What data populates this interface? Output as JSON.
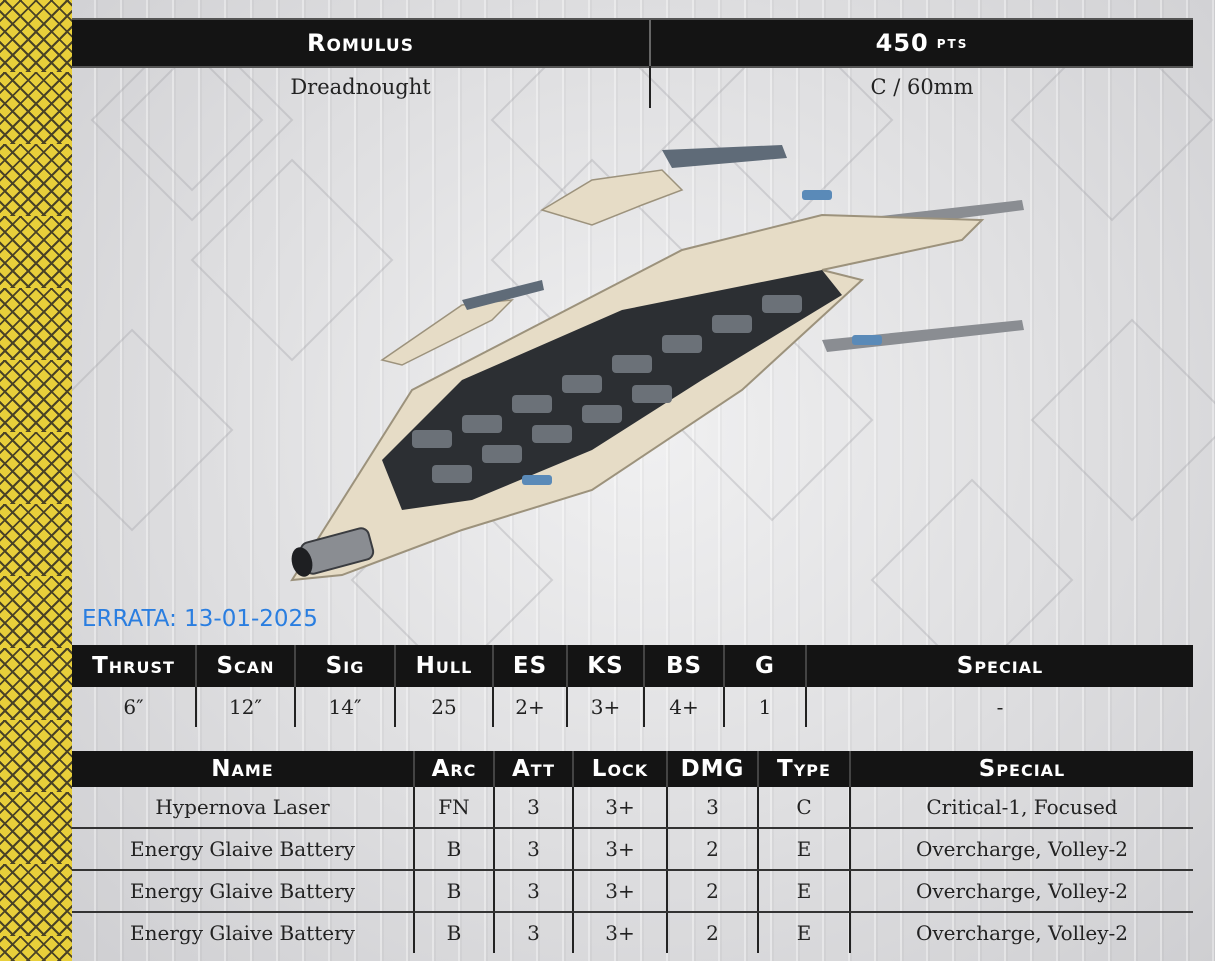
{
  "header": {
    "name": "Romulus",
    "points": "450",
    "points_unit": "pts",
    "class": "Dreadnought",
    "base": "C / 60mm"
  },
  "errata": "ERRATA: 13-01-2025",
  "stats": {
    "headers": [
      "Thrust",
      "Scan",
      "Sig",
      "Hull",
      "ES",
      "KS",
      "BS",
      "G",
      "Special"
    ],
    "values": [
      "6″",
      "12″",
      "14″",
      "25",
      "2+",
      "3+",
      "4+",
      "1",
      "-"
    ]
  },
  "weapons": {
    "headers": [
      "Name",
      "Arc",
      "Att",
      "Lock",
      "DMG",
      "Type",
      "Special"
    ],
    "rows": [
      [
        "Hypernova Laser",
        "FN",
        "3",
        "3+",
        "3",
        "C",
        "Critical-1, Focused"
      ],
      [
        "Energy Glaive Battery",
        "B",
        "3",
        "3+",
        "2",
        "E",
        "Overcharge, Volley-2"
      ],
      [
        "Energy Glaive Battery",
        "B",
        "3",
        "3+",
        "2",
        "E",
        "Overcharge, Volley-2"
      ],
      [
        "Energy Glaive Battery",
        "B",
        "3",
        "3+",
        "2",
        "E",
        "Overcharge, Volley-2"
      ]
    ]
  },
  "colors": {
    "header_bg": "#141414",
    "errata": "#2a7ee0",
    "side_band": "#e8cf3a",
    "hull": "#e6dcc6"
  },
  "image": "ship-miniature-photo"
}
